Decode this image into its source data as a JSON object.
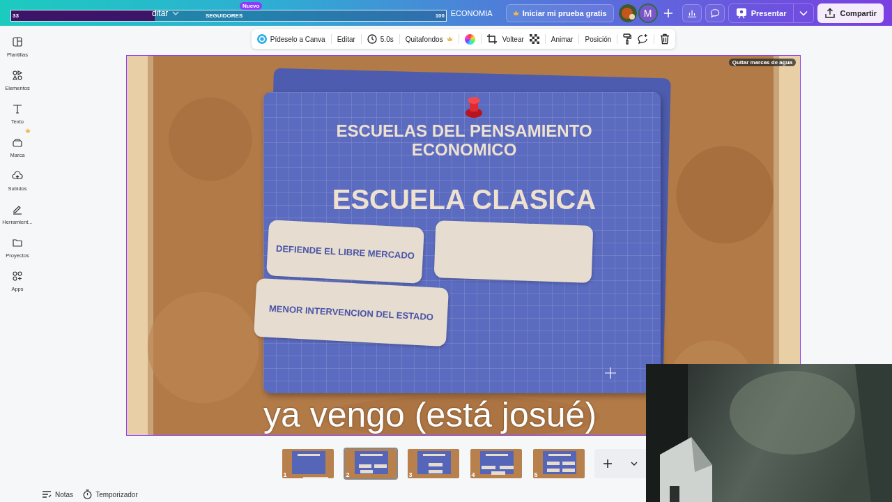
{
  "stream_overlay": {
    "start": "33",
    "label": "SEGUIDORES",
    "end": "100",
    "level": 0.33,
    "badge": "Nuevo"
  },
  "header": {
    "menu_partial": "ditar",
    "doc_title": "ECONOMIA",
    "trial_button": "Iniciar mi prueba gratis",
    "avatar_initial": "M",
    "present_button": "Presentar",
    "share_button": "Compartir"
  },
  "sidebar": {
    "items": [
      {
        "kind": "templates",
        "label": "Plantillas",
        "premium": false
      },
      {
        "kind": "elements",
        "label": "Elementos",
        "premium": false
      },
      {
        "kind": "text",
        "label": "Texto",
        "premium": false
      },
      {
        "kind": "brand",
        "label": "Marca",
        "premium": true
      },
      {
        "kind": "uploads",
        "label": "Subidos",
        "premium": false
      },
      {
        "kind": "tools",
        "label": "Herramient...",
        "premium": false
      },
      {
        "kind": "projects",
        "label": "Proyectos",
        "premium": false
      },
      {
        "kind": "apps",
        "label": "Apps",
        "premium": false
      }
    ]
  },
  "toolbar": {
    "items": [
      {
        "kind": "ai",
        "label": "Pídeselo a Canva"
      },
      {
        "kind": "text",
        "label": "Editar"
      },
      {
        "kind": "timer",
        "label": "5.0s"
      },
      {
        "kind": "premium",
        "label": "Quitafondos"
      },
      {
        "kind": "color"
      },
      {
        "kind": "crop"
      },
      {
        "kind": "text",
        "label": "Voltear"
      },
      {
        "kind": "transparency"
      },
      {
        "kind": "text",
        "label": "Animar"
      },
      {
        "kind": "text",
        "label": "Posición"
      },
      {
        "kind": "paint"
      },
      {
        "kind": "comment"
      },
      {
        "kind": "delete"
      }
    ]
  },
  "slide": {
    "watermark_button": "Quitar marcas de agua",
    "title": "ESCUELAS DEL PENSAMIENTO ECONOMICO",
    "heading": "ESCUELA CLASICA",
    "boxes": [
      {
        "kind": "text",
        "text": "DEFIENDE EL LIBRE MERCADO"
      },
      {
        "kind": "blank"
      },
      {
        "kind": "text",
        "text": "MENOR INTERVENCION DEL ESTADO"
      }
    ]
  },
  "caption": "ya vengo (está josué)",
  "pages": [
    {
      "number": "1",
      "selected": false
    },
    {
      "number": "2",
      "selected": true
    },
    {
      "number": "3",
      "selected": false
    },
    {
      "number": "4",
      "selected": false
    },
    {
      "number": "5",
      "selected": false
    }
  ],
  "footer": {
    "notes": "Notas",
    "timer": "Temporizador"
  }
}
